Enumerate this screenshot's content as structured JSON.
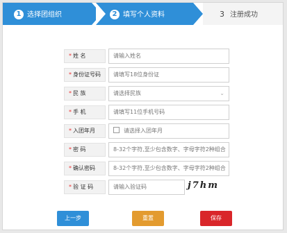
{
  "steps": [
    {
      "number": "1",
      "label": "选择团组织"
    },
    {
      "number": "2",
      "label": "填写个人资料"
    },
    {
      "number": "3",
      "label": "注册成功"
    }
  ],
  "form": {
    "rows": [
      {
        "label": "姓    名",
        "placeholder": "请输入姓名"
      },
      {
        "label": "身份证号码",
        "placeholder": "请填写18位身份证"
      },
      {
        "label": "民    族",
        "placeholder": "请选择民族"
      },
      {
        "label": "手    机",
        "placeholder": "请填写11位手机号码"
      },
      {
        "label": "入团年月",
        "placeholder": "请选择入团年月"
      },
      {
        "label": "密    码",
        "placeholder": "8-32个字符,至少包含数字、字母字符2种组合"
      },
      {
        "label": "确认密码",
        "placeholder": "8-32个字符,至少包含数字、字母字符2种组合"
      },
      {
        "label": "验 证 码",
        "placeholder": "请输入验证码"
      }
    ],
    "captcha_text": "j7hm"
  },
  "buttons": {
    "prev": "上一步",
    "reset": "重置",
    "save": "保存"
  },
  "colors": {
    "blue": "#2f8fd8",
    "orange": "#e39b2f",
    "red": "#d9262a"
  }
}
